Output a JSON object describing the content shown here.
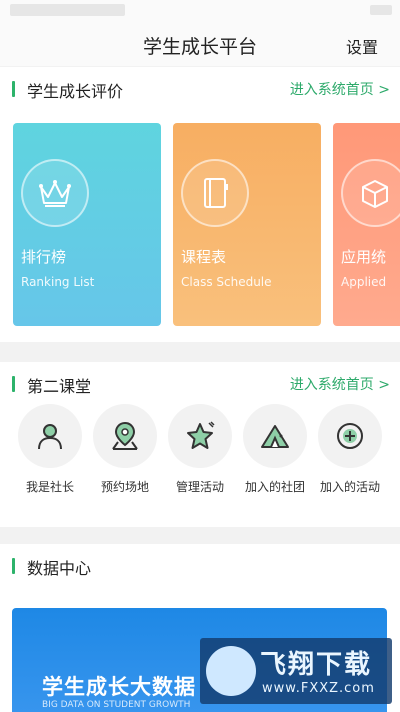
{
  "header": {
    "title": "学生成长平台",
    "settings_label": "设置"
  },
  "evaluation": {
    "title": "学生成长评价",
    "link": "进入系统首页 >",
    "cards": [
      {
        "cn": "排行榜",
        "en": "Ranking List",
        "icon": "crown-icon",
        "color_top": "#5fd3e0",
        "color_bottom": "#66c7e8"
      },
      {
        "cn": "课程表",
        "en": "Class Schedule",
        "icon": "notebook-icon",
        "color_top": "#f7b066",
        "color_bottom": "#f9c079"
      },
      {
        "cn": "应用统",
        "en": "Applied",
        "icon": "box-icon",
        "color_top": "#ff9a7a",
        "color_bottom": "#ffa88c"
      }
    ]
  },
  "second_class": {
    "title": "第二课堂",
    "link": "进入系统首页 >",
    "items": [
      {
        "label": "我是社长",
        "icon": "person-icon"
      },
      {
        "label": "预约场地",
        "icon": "location-icon"
      },
      {
        "label": "管理活动",
        "icon": "star-icon"
      },
      {
        "label": "加入的社团",
        "icon": "tent-icon"
      },
      {
        "label": "加入的活动",
        "icon": "plus-circle-icon"
      }
    ]
  },
  "data_center": {
    "title": "数据中心",
    "banner_title": "学生成长大数据",
    "banner_subtitle": "BIG DATA ON STUDENT GROWTH"
  },
  "watermark": {
    "name": "飞翔下载",
    "url": "www.FXXZ.com"
  },
  "colors": {
    "accent": "#2db36b",
    "link": "#2eaa6b",
    "banner": "#1e88e5"
  }
}
